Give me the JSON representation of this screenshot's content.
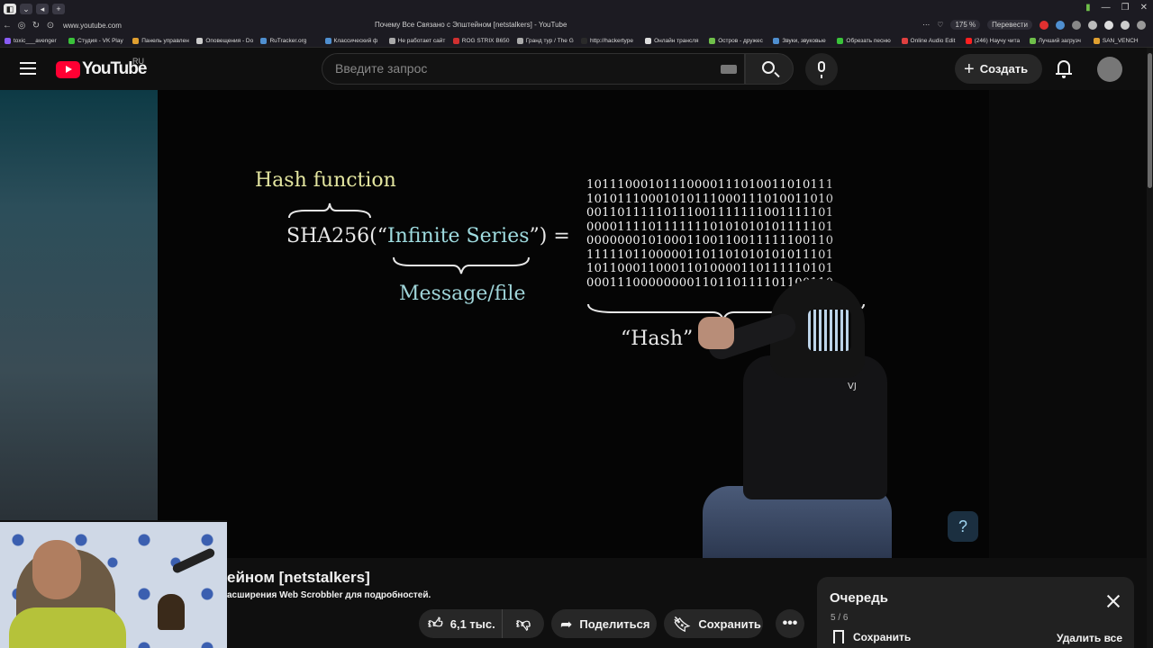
{
  "browser": {
    "address": "www.youtube.com",
    "tab_title": "Почему Все Связано с Эпштейном [netstalkers] - YouTube",
    "zoom": "175 %",
    "translate_label": "Перевести",
    "bookmarks": [
      {
        "label": "toxic___avenger",
        "color": "#8a5cf6"
      },
      {
        "label": "Студия - VK Play",
        "color": "#3ac23a"
      },
      {
        "label": "Панель управлен",
        "color": "#e0a030"
      },
      {
        "label": "Оповещения - Do",
        "color": "#cccccc"
      },
      {
        "label": "RuTracker.org",
        "color": "#4f8fd0"
      },
      {
        "label": "Классический ф",
        "color": "#4f8fd0"
      },
      {
        "label": "Не работает сайт",
        "color": "#aaaaaa"
      },
      {
        "label": "ROG STRIX B650",
        "color": "#d03030"
      },
      {
        "label": "Гранд тур / The G",
        "color": "#aaaaaa"
      },
      {
        "label": "http://hackertype",
        "color": "#2a2a2a"
      },
      {
        "label": "Онлайн трансля",
        "color": "#dddddd"
      },
      {
        "label": "Остров - дружес",
        "color": "#6fbf4a"
      },
      {
        "label": "Звуки, звуковые",
        "color": "#4f8fd0"
      },
      {
        "label": "Обрезать песню",
        "color": "#3ac23a"
      },
      {
        "label": "Online Audio Edit",
        "color": "#e04040"
      },
      {
        "label": "(246) Научу чита",
        "color": "#ff2020"
      },
      {
        "label": "Лучший загрузч",
        "color": "#6fbf4a"
      },
      {
        "label": "SAN_VENCH",
        "color": "#e0a030"
      }
    ]
  },
  "header": {
    "logo_text": "YouTube",
    "region": "RU",
    "search_placeholder": "Введите запрос",
    "create_label": "Создать"
  },
  "video_frame": {
    "hash_function": "Hash function",
    "sha_prefix": "SHA256(“",
    "sha_literal": "Infinite Series",
    "sha_suffix": "”) =",
    "message_label": "Message/file",
    "hash_label": "“Hash”",
    "bit_rows": [
      "10111000101110000111010011010111",
      "10101110001010111000111010011010",
      "00110111110111001111111001111101",
      "00001111011111110101010101111101",
      "00000001010001100110011111100110",
      "11111011000001101101010101011101",
      "10110001100011010000110111110101",
      "00011100000000110110111101100110"
    ],
    "figure_logo": "VJ",
    "channel_badge": "?"
  },
  "video": {
    "title_visible": "ейном [netstalkers]",
    "scrobbler_note": "асширения Web Scrobbler для подробностей."
  },
  "actions": {
    "like_count": "6,1 тыс.",
    "share_label": "Поделиться",
    "save_label": "Сохранить",
    "more_label": "•••"
  },
  "queue": {
    "title": "Очередь",
    "position": "5 / 6",
    "save_label": "Сохранить",
    "delete_all_label": "Удалить все"
  }
}
